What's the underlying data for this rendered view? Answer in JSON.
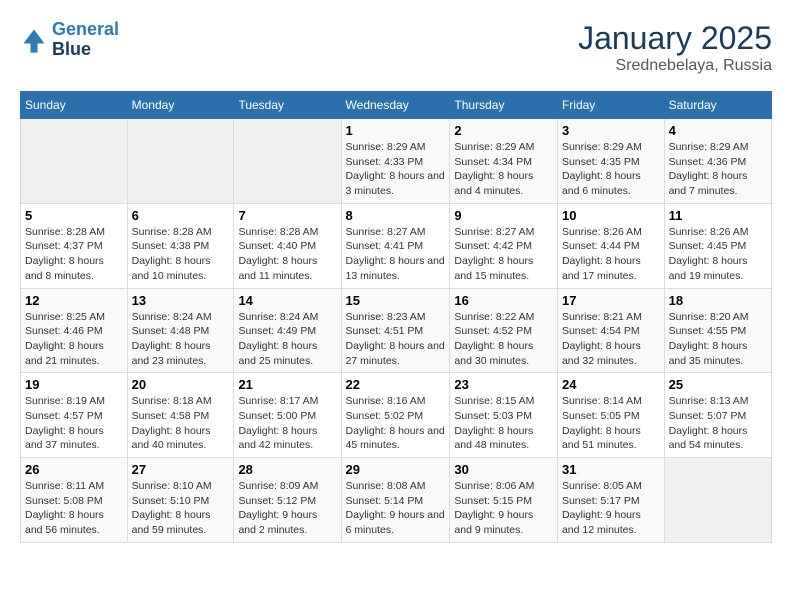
{
  "header": {
    "logo_line1": "General",
    "logo_line2": "Blue",
    "title": "January 2025",
    "subtitle": "Srednebelaya, Russia"
  },
  "weekdays": [
    "Sunday",
    "Monday",
    "Tuesday",
    "Wednesday",
    "Thursday",
    "Friday",
    "Saturday"
  ],
  "weeks": [
    [
      {
        "day": "",
        "sunrise": "",
        "sunset": "",
        "daylight": ""
      },
      {
        "day": "",
        "sunrise": "",
        "sunset": "",
        "daylight": ""
      },
      {
        "day": "",
        "sunrise": "",
        "sunset": "",
        "daylight": ""
      },
      {
        "day": "1",
        "sunrise": "Sunrise: 8:29 AM",
        "sunset": "Sunset: 4:33 PM",
        "daylight": "Daylight: 8 hours and 3 minutes."
      },
      {
        "day": "2",
        "sunrise": "Sunrise: 8:29 AM",
        "sunset": "Sunset: 4:34 PM",
        "daylight": "Daylight: 8 hours and 4 minutes."
      },
      {
        "day": "3",
        "sunrise": "Sunrise: 8:29 AM",
        "sunset": "Sunset: 4:35 PM",
        "daylight": "Daylight: 8 hours and 6 minutes."
      },
      {
        "day": "4",
        "sunrise": "Sunrise: 8:29 AM",
        "sunset": "Sunset: 4:36 PM",
        "daylight": "Daylight: 8 hours and 7 minutes."
      }
    ],
    [
      {
        "day": "5",
        "sunrise": "Sunrise: 8:28 AM",
        "sunset": "Sunset: 4:37 PM",
        "daylight": "Daylight: 8 hours and 8 minutes."
      },
      {
        "day": "6",
        "sunrise": "Sunrise: 8:28 AM",
        "sunset": "Sunset: 4:38 PM",
        "daylight": "Daylight: 8 hours and 10 minutes."
      },
      {
        "day": "7",
        "sunrise": "Sunrise: 8:28 AM",
        "sunset": "Sunset: 4:40 PM",
        "daylight": "Daylight: 8 hours and 11 minutes."
      },
      {
        "day": "8",
        "sunrise": "Sunrise: 8:27 AM",
        "sunset": "Sunset: 4:41 PM",
        "daylight": "Daylight: 8 hours and 13 minutes."
      },
      {
        "day": "9",
        "sunrise": "Sunrise: 8:27 AM",
        "sunset": "Sunset: 4:42 PM",
        "daylight": "Daylight: 8 hours and 15 minutes."
      },
      {
        "day": "10",
        "sunrise": "Sunrise: 8:26 AM",
        "sunset": "Sunset: 4:44 PM",
        "daylight": "Daylight: 8 hours and 17 minutes."
      },
      {
        "day": "11",
        "sunrise": "Sunrise: 8:26 AM",
        "sunset": "Sunset: 4:45 PM",
        "daylight": "Daylight: 8 hours and 19 minutes."
      }
    ],
    [
      {
        "day": "12",
        "sunrise": "Sunrise: 8:25 AM",
        "sunset": "Sunset: 4:46 PM",
        "daylight": "Daylight: 8 hours and 21 minutes."
      },
      {
        "day": "13",
        "sunrise": "Sunrise: 8:24 AM",
        "sunset": "Sunset: 4:48 PM",
        "daylight": "Daylight: 8 hours and 23 minutes."
      },
      {
        "day": "14",
        "sunrise": "Sunrise: 8:24 AM",
        "sunset": "Sunset: 4:49 PM",
        "daylight": "Daylight: 8 hours and 25 minutes."
      },
      {
        "day": "15",
        "sunrise": "Sunrise: 8:23 AM",
        "sunset": "Sunset: 4:51 PM",
        "daylight": "Daylight: 8 hours and 27 minutes."
      },
      {
        "day": "16",
        "sunrise": "Sunrise: 8:22 AM",
        "sunset": "Sunset: 4:52 PM",
        "daylight": "Daylight: 8 hours and 30 minutes."
      },
      {
        "day": "17",
        "sunrise": "Sunrise: 8:21 AM",
        "sunset": "Sunset: 4:54 PM",
        "daylight": "Daylight: 8 hours and 32 minutes."
      },
      {
        "day": "18",
        "sunrise": "Sunrise: 8:20 AM",
        "sunset": "Sunset: 4:55 PM",
        "daylight": "Daylight: 8 hours and 35 minutes."
      }
    ],
    [
      {
        "day": "19",
        "sunrise": "Sunrise: 8:19 AM",
        "sunset": "Sunset: 4:57 PM",
        "daylight": "Daylight: 8 hours and 37 minutes."
      },
      {
        "day": "20",
        "sunrise": "Sunrise: 8:18 AM",
        "sunset": "Sunset: 4:58 PM",
        "daylight": "Daylight: 8 hours and 40 minutes."
      },
      {
        "day": "21",
        "sunrise": "Sunrise: 8:17 AM",
        "sunset": "Sunset: 5:00 PM",
        "daylight": "Daylight: 8 hours and 42 minutes."
      },
      {
        "day": "22",
        "sunrise": "Sunrise: 8:16 AM",
        "sunset": "Sunset: 5:02 PM",
        "daylight": "Daylight: 8 hours and 45 minutes."
      },
      {
        "day": "23",
        "sunrise": "Sunrise: 8:15 AM",
        "sunset": "Sunset: 5:03 PM",
        "daylight": "Daylight: 8 hours and 48 minutes."
      },
      {
        "day": "24",
        "sunrise": "Sunrise: 8:14 AM",
        "sunset": "Sunset: 5:05 PM",
        "daylight": "Daylight: 8 hours and 51 minutes."
      },
      {
        "day": "25",
        "sunrise": "Sunrise: 8:13 AM",
        "sunset": "Sunset: 5:07 PM",
        "daylight": "Daylight: 8 hours and 54 minutes."
      }
    ],
    [
      {
        "day": "26",
        "sunrise": "Sunrise: 8:11 AM",
        "sunset": "Sunset: 5:08 PM",
        "daylight": "Daylight: 8 hours and 56 minutes."
      },
      {
        "day": "27",
        "sunrise": "Sunrise: 8:10 AM",
        "sunset": "Sunset: 5:10 PM",
        "daylight": "Daylight: 8 hours and 59 minutes."
      },
      {
        "day": "28",
        "sunrise": "Sunrise: 8:09 AM",
        "sunset": "Sunset: 5:12 PM",
        "daylight": "Daylight: 9 hours and 2 minutes."
      },
      {
        "day": "29",
        "sunrise": "Sunrise: 8:08 AM",
        "sunset": "Sunset: 5:14 PM",
        "daylight": "Daylight: 9 hours and 6 minutes."
      },
      {
        "day": "30",
        "sunrise": "Sunrise: 8:06 AM",
        "sunset": "Sunset: 5:15 PM",
        "daylight": "Daylight: 9 hours and 9 minutes."
      },
      {
        "day": "31",
        "sunrise": "Sunrise: 8:05 AM",
        "sunset": "Sunset: 5:17 PM",
        "daylight": "Daylight: 9 hours and 12 minutes."
      },
      {
        "day": "",
        "sunrise": "",
        "sunset": "",
        "daylight": ""
      }
    ]
  ]
}
